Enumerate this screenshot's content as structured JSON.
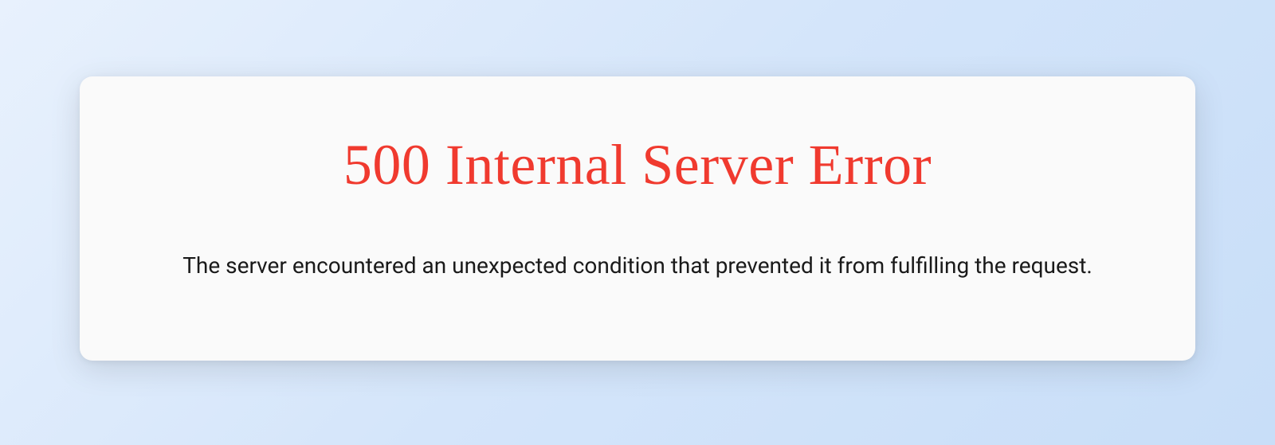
{
  "error": {
    "title": "500 Internal Server Error",
    "message": "The server encountered an unexpected condition that prevented it from fulfilling the request."
  },
  "colors": {
    "title_color": "#f03a2f",
    "message_color": "#1a1a1a",
    "card_background": "#fafafa"
  }
}
